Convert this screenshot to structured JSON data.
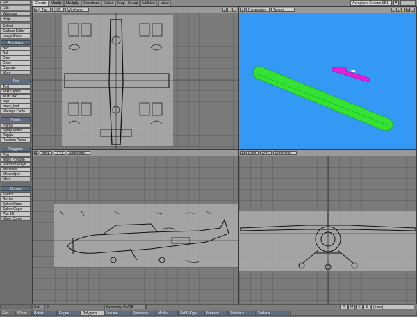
{
  "top_tabs": [
    "Create",
    "Modify",
    "Multiply",
    "Construct",
    "Detail",
    "Map",
    "Setup",
    "Utilities",
    "View"
  ],
  "active_tab": "Create",
  "scene_select": "Aeroplane Cessna SB1 ...",
  "left_menus": {
    "file": "File",
    "edit": "Edit",
    "windows": "Windows",
    "help": "Help",
    "select": "Select",
    "surface_editor": "Surface Editor",
    "image_editor": "Image Editor"
  },
  "primitives": {
    "header": "Primitives",
    "items": [
      "Box",
      "Ball",
      "Disc",
      "Cone",
      "Capsule",
      "More"
    ]
  },
  "text": {
    "header": "Text",
    "items": [
      "Text",
      "Text Layers",
      "Multi Text",
      "logo",
      "make_text",
      "Manage Fonts"
    ]
  },
  "points": {
    "header": "Points",
    "items": [
      "Points",
      "Spray Points",
      "Stipple",
      "Random Points"
    ]
  },
  "polygons": {
    "header": "Polygons",
    "items": [
      "Pen",
      "Make Polygon",
      "Points to Polys",
      "Metaballs",
      "Metaedges",
      "More"
    ]
  },
  "curves": {
    "header": "Curves",
    "items": [
      "Sketch",
      "Bezier",
      "Spline Draw",
      "Spline Cage",
      "Plot 1D",
      "Make Curve"
    ]
  },
  "viewports": {
    "top": {
      "label": "Top",
      "axis": "(XZ)",
      "mode": "Wireframe"
    },
    "perspective": {
      "label": "Perspective",
      "mode": "Texture"
    },
    "back": {
      "label": "Back",
      "axis": "(XY)",
      "mode": "Wireframe"
    },
    "right": {
      "label": "Right",
      "axis": "(ZY)",
      "mode": "Wireframe"
    }
  },
  "bottom": {
    "set_label": "Set",
    "set_value": "0",
    "symmetry_label": "Symmetry On/Off",
    "grid_label": "Grid",
    "grid_value": "50 cm",
    "toggles": [
      "T",
      "M",
      "C",
      "S"
    ],
    "layer_select": "(none)",
    "buttons": [
      "Points",
      "Edges",
      "Polygons",
      "Volume",
      "Symmetry",
      "Modes",
      "SubD-Type",
      "Numeric",
      "Statistics",
      "Surface"
    ]
  },
  "colors": {
    "perspective_bg": "#3399f4",
    "wing": "#33e233",
    "tail": "#e61ed8",
    "header_blue": "#5c6d82"
  }
}
